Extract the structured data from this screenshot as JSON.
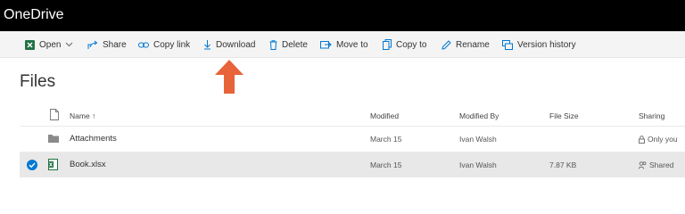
{
  "app": {
    "title": "OneDrive"
  },
  "toolbar": {
    "open": "Open",
    "share": "Share",
    "copy_link": "Copy link",
    "download": "Download",
    "delete": "Delete",
    "move_to": "Move to",
    "copy_to": "Copy to",
    "rename": "Rename",
    "version_history": "Version history"
  },
  "page": {
    "heading": "Files"
  },
  "columns": {
    "name": "Name ↑",
    "modified": "Modified",
    "modified_by": "Modified By",
    "file_size": "File Size",
    "sharing": "Sharing"
  },
  "files": [
    {
      "name": "Attachments",
      "modified": "March 15",
      "modified_by": "Ivan Walsh",
      "file_size": "",
      "sharing": "Only you",
      "type": "folder",
      "selected": false
    },
    {
      "name": "Book.xlsx",
      "modified": "March 15",
      "modified_by": "Ivan Walsh",
      "file_size": "7.87 KB",
      "sharing": "Shared",
      "type": "excel",
      "selected": true
    }
  ],
  "colors": {
    "titlebar": "#000000",
    "accent": "#0078d4",
    "excel": "#217346",
    "annotation_arrow": "#e8623a",
    "selected_row": "#e8e8e8"
  }
}
